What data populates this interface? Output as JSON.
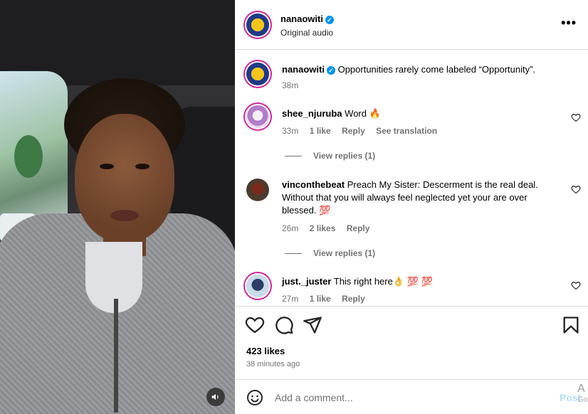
{
  "post": {
    "author": "nanaowiti",
    "audio": "Original audio",
    "caption": "Opportunities rarely come labeled “Opportunity”.",
    "caption_time": "38m"
  },
  "comments": [
    {
      "username": "shee_njuruba",
      "text": "Word 🔥",
      "time": "33m",
      "likes": "1 like",
      "reply": "Reply",
      "translate": "See translation",
      "view_replies": "View replies (1)"
    },
    {
      "username": "vinconthebeat",
      "text": "Preach My Sister: Descerment is the real deal. Without that you will always feel neglected yet your are over blessed. 💯",
      "time": "26m",
      "likes": "2 likes",
      "reply": "Reply",
      "view_replies": "View replies (1)"
    },
    {
      "username": "just._juster",
      "text": "This right here👌 💯 💯",
      "time": "27m",
      "likes": "1 like",
      "reply": "Reply"
    }
  ],
  "engagement": {
    "likes": "423 likes",
    "posted": "38 minutes ago"
  },
  "add_comment": {
    "placeholder": "Add a comment...",
    "post_label": "Post"
  },
  "edge": {
    "line1": "A",
    "line2": "Go"
  },
  "colors": {
    "accent": "#0095f6",
    "muted": "#737373",
    "story_ring": "#d6249f",
    "post_disabled": "#b3dffc"
  }
}
